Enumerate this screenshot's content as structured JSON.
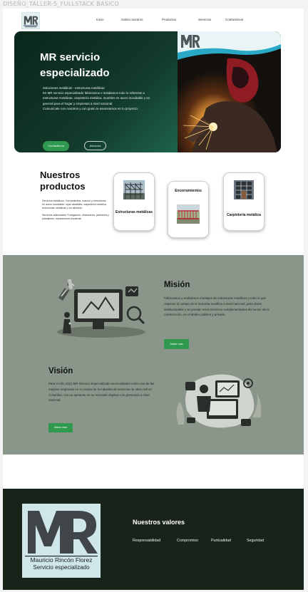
{
  "canvas_title": "DISEÑO_TALLER-5_FULLSTACK BASICO",
  "nav": {
    "logo_text": "MR",
    "links": [
      "Inicio",
      "Sobre nosotros",
      "Productos",
      "Servicios",
      "Contactenos"
    ]
  },
  "hero": {
    "title": "MR servicio especializado",
    "lines": [
      "Soluciones metálicas - estructuras metálicas",
      "En MR servicio especializado fabricamos e instalamos todo lo referente a estructuras metálicas, carpintería metálica, muebles en acero inoxidable y en general para el hogar y empresas a nivel nacional.",
      "Comunícate con nosotros y con gusto te asesoramos en tu proyecto."
    ],
    "contact_button": "Contactenos",
    "advice_button": "Asesoría",
    "image_logo_text": "MR"
  },
  "products": {
    "title_line1": "Nuestros",
    "title_line2": "productos",
    "metal_services": "Servicios metálicos: Cerramientos, marcos y estructuras en acero inoxidable, rejas abatibles, carpintería metálica, estructuras metálicas y en aluminio.",
    "additional_services": "Servicios adicionales: Fumigación, ebanistería, jardinería y paisajismo, reparaciones locativas.",
    "cards": [
      {
        "label": "Estructuras metálicas"
      },
      {
        "label": "Encerramientos"
      },
      {
        "label": "Carpintería metálica"
      }
    ]
  },
  "mission": {
    "title": "Misión",
    "text": "Fabricamos y realizamos montajes de estructuras metálicas y todo lo que respecte al campo de la industria metálica a nivel nacional, para obras institucionales y se prestan otros servicios complementarios del sector de la construcción, en el ámbito público y privado.",
    "button": "Saber mas"
  },
  "vision": {
    "title": "Visión",
    "text": "Para el año 2021 MR Servicio Especializado seconsolidara como una de las mejores empresas en el campo de la industria de servicios de obra civil en Colombia, con un aumento en su mercado objetivo con presencia a nivel nacional.",
    "button": "Saber mas"
  },
  "values": {
    "title": "Nuestros valores",
    "items": [
      "Responsabilidad",
      "Compromiso",
      "Puntualidad",
      "Seguridad"
    ],
    "logo_letters": "MR",
    "logo_name": "Mauricio Rincón Florez",
    "logo_tagline": "Servicio especializado"
  },
  "colors": {
    "hero_dark": "#0a261b",
    "hero_teal": "#39a58d",
    "accent_green": "#2f9a4f",
    "mv_background": "#8b968a",
    "footer_background": "#18231a"
  }
}
